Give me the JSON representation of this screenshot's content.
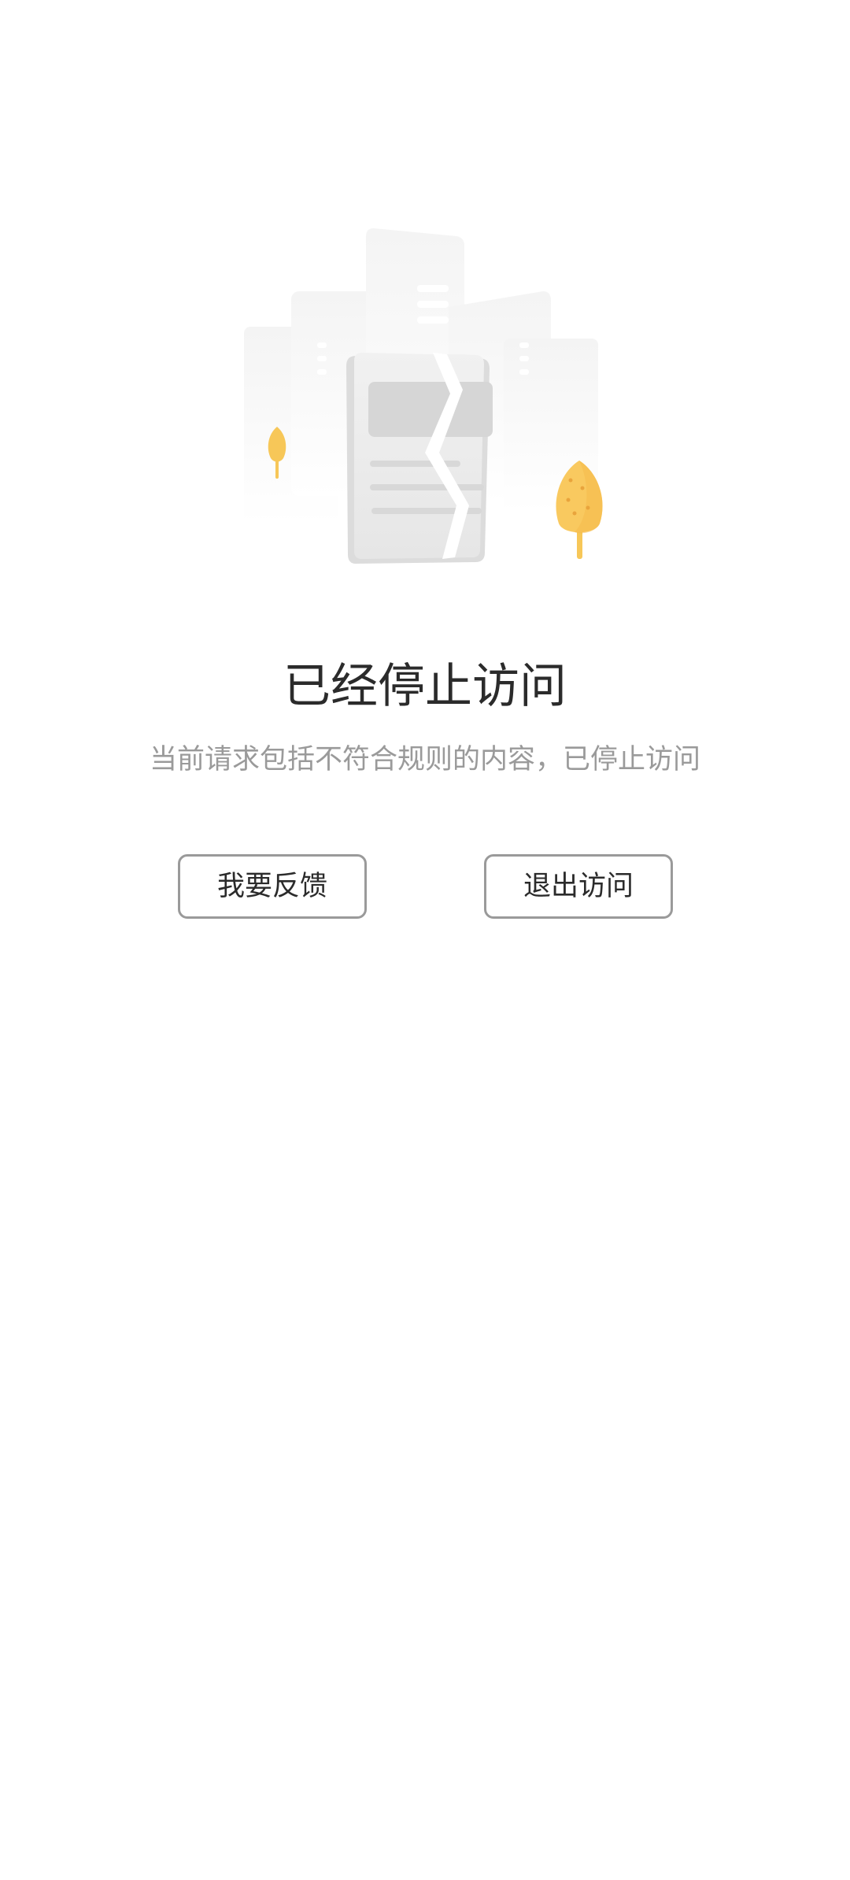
{
  "page": {
    "title": "已经停止访问",
    "subtitle": "当前请求包括不符合规则的内容，已停止访问"
  },
  "actions": {
    "feedback_label": "我要反馈",
    "exit_label": "退出访问"
  },
  "colors": {
    "background": "#ffffff",
    "title_text": "#2b2b2b",
    "subtitle_text": "#9a9a9a",
    "button_border": "#9a9a9a",
    "tree_accent": "#f7c758"
  },
  "illustration": {
    "name": "broken-document-illustration"
  }
}
